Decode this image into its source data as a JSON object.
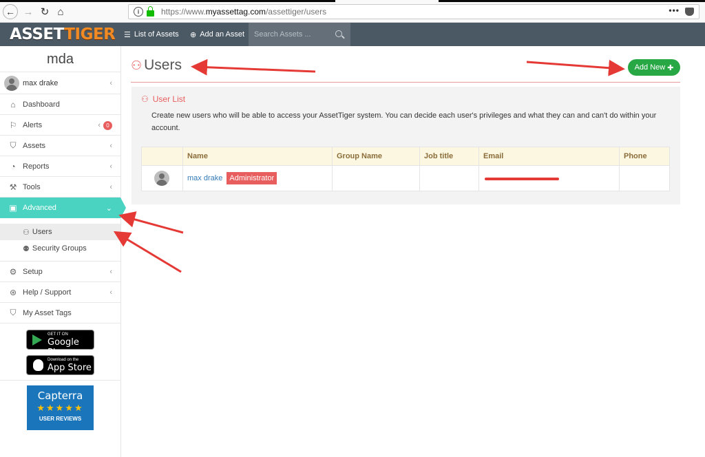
{
  "browser": {
    "url_prefix": "https://www.",
    "url_domain": "myassettag.com",
    "url_path": "/assettiger/users",
    "menu_dots": "•••"
  },
  "app": {
    "logo_left": "ASSET",
    "logo_right": "TIGER",
    "nav": {
      "list_assets": "List of Assets",
      "add_asset": "Add an Asset"
    },
    "search_placeholder": "Search Assets ..."
  },
  "sidebar": {
    "org_name": "mda",
    "user_name": "max drake",
    "items": [
      {
        "label": "Dashboard",
        "icon": "home-icon"
      },
      {
        "label": "Alerts",
        "icon": "flag-icon",
        "badge": "0"
      },
      {
        "label": "Assets",
        "icon": "tag-icon"
      },
      {
        "label": "Reports",
        "icon": "dashboard-gauge-icon"
      },
      {
        "label": "Tools",
        "icon": "wrench-icon"
      },
      {
        "label": "Advanced",
        "icon": "briefcase-icon",
        "active": true
      }
    ],
    "advanced_sub": [
      {
        "label": "Users",
        "icon": "user-icon",
        "selected": true
      },
      {
        "label": "Security Groups",
        "icon": "users-icon"
      }
    ],
    "items_after": [
      {
        "label": "Setup",
        "icon": "gear-icon"
      },
      {
        "label": "Help / Support",
        "icon": "lifebuoy-icon"
      },
      {
        "label": "My Asset Tags",
        "icon": "tags-icon"
      }
    ],
    "google_play": {
      "small": "GET IT ON",
      "big": "Google Play"
    },
    "app_store": {
      "small": "Download on the",
      "big": "App Store"
    },
    "capterra": {
      "name": "Capterra",
      "stars": "★★★★★",
      "reviews": "USER REVIEWS"
    }
  },
  "main": {
    "title": "Users",
    "add_new_label": "Add New",
    "panel_title": "User List",
    "description": "Create new users who will be able to access your AssetTiger system. You can decide each user's privileges and what they can and can't do within your account.",
    "table": {
      "headers": [
        "",
        "Name",
        "Group Name",
        "Job title",
        "Email",
        "Phone"
      ],
      "rows": [
        {
          "name": "max drake",
          "role": "Administrator",
          "group": "",
          "job": "",
          "email": "",
          "phone": ""
        }
      ]
    }
  },
  "colors": {
    "accent_teal": "#49d3c0",
    "header_bg": "#4b5965",
    "danger": "#e85d5d",
    "success": "#28a745",
    "annotation_red": "#e53935"
  }
}
